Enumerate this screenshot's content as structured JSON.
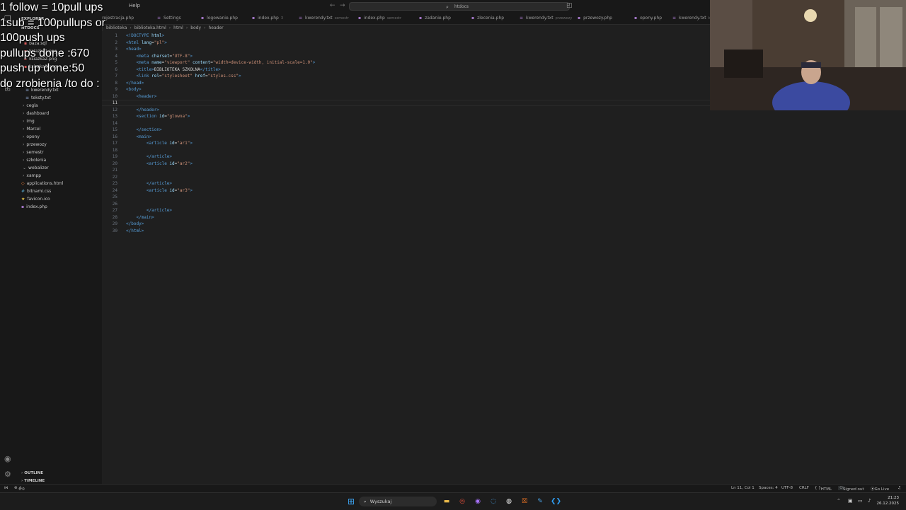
{
  "menu": {
    "help": "Help"
  },
  "search": {
    "text": "htdocs"
  },
  "overlay_lines": [
    "1 follow = 10pull ups",
    "1sub = 100pullups or",
    "100push ups",
    "pullups done :670",
    "push up done:50",
    "do zrobienia /to do :"
  ],
  "explorer": {
    "title": "EXPLORER",
    "root": "HTDOCS",
    "files_top": [
      "baza.sql",
      "ksiazka1.png",
      "ksiazka2.png",
      "ksiazka3.png"
    ],
    "files_txt": [
      "kwerendy.txt",
      "teksty.txt"
    ],
    "folders": [
      "cegla",
      "dashboard",
      "img",
      "Marcel",
      "opony",
      "przewozy",
      "semestr",
      "szkolenia",
      "webalizer",
      "xampp"
    ],
    "files_bottom": [
      "applications.html",
      "bitnami.css",
      "favicon.ico",
      "index.php"
    ],
    "outline": "OUTLINE",
    "timeline": "TIMELINE"
  },
  "tabs": [
    {
      "label": "rejestracja.php",
      "desc": ""
    },
    {
      "label": "Settings",
      "desc": ""
    },
    {
      "label": "logowanie.php",
      "desc": ""
    },
    {
      "label": "index.php",
      "desc": "3"
    },
    {
      "label": "kwerendy.txt",
      "desc": "semestr"
    },
    {
      "label": "index.php",
      "desc": "semestr"
    },
    {
      "label": "zadanie.php",
      "desc": ""
    },
    {
      "label": "zlecenia.php",
      "desc": ""
    },
    {
      "label": "kwerendy.txt",
      "desc": "przewozy"
    },
    {
      "label": "przewozy.php",
      "desc": ""
    },
    {
      "label": "opony.php",
      "desc": ""
    },
    {
      "label": "kwerendy.txt",
      "desc": "bi"
    }
  ],
  "breadcrumb": [
    "biblioteka",
    "biblioteka.html",
    "html",
    "body",
    "header"
  ],
  "code_lines": [
    {
      "n": "1",
      "t": [
        [
          "tg",
          "<!DOCTYPE "
        ],
        [
          "at",
          "html"
        ],
        [
          "tg",
          ">"
        ]
      ]
    },
    {
      "n": "2",
      "t": [
        [
          "tg",
          "<html "
        ],
        [
          "at",
          "lang"
        ],
        [
          "tx",
          "="
        ],
        [
          "st",
          "\"pl\""
        ],
        [
          "tg",
          ">"
        ]
      ]
    },
    {
      "n": "3",
      "t": [
        [
          "tg",
          "<head>"
        ]
      ]
    },
    {
      "n": "4",
      "t": [
        [
          "tx",
          "    "
        ],
        [
          "tg",
          "<meta "
        ],
        [
          "at",
          "charset"
        ],
        [
          "tx",
          "="
        ],
        [
          "st",
          "\"UTF-8\""
        ],
        [
          "tg",
          ">"
        ]
      ]
    },
    {
      "n": "5",
      "t": [
        [
          "tx",
          "    "
        ],
        [
          "tg",
          "<meta "
        ],
        [
          "at",
          "name"
        ],
        [
          "tx",
          "="
        ],
        [
          "st",
          "\"viewport\" "
        ],
        [
          "at",
          "content"
        ],
        [
          "tx",
          "="
        ],
        [
          "st",
          "\"width=device-width, initial-scale=1.0\""
        ],
        [
          "tg",
          ">"
        ]
      ]
    },
    {
      "n": "6",
      "t": [
        [
          "tx",
          "    "
        ],
        [
          "tg",
          "<title>"
        ],
        [
          "tx",
          "BIBLIOTEKA SZKOLNA"
        ],
        [
          "tg",
          "</title>"
        ]
      ]
    },
    {
      "n": "7",
      "t": [
        [
          "tx",
          "    "
        ],
        [
          "tg",
          "<link "
        ],
        [
          "at",
          "rel"
        ],
        [
          "tx",
          "="
        ],
        [
          "st",
          "\"stylesheet\" "
        ],
        [
          "at",
          "href"
        ],
        [
          "tx",
          "="
        ],
        [
          "st",
          "\"styles.css\""
        ],
        [
          "tg",
          ">"
        ]
      ]
    },
    {
      "n": "8",
      "t": [
        [
          "tg",
          "</head>"
        ]
      ]
    },
    {
      "n": "9",
      "t": [
        [
          "tg",
          "<body>"
        ]
      ]
    },
    {
      "n": "10",
      "t": [
        [
          "tx",
          "    "
        ],
        [
          "tg",
          "<header>"
        ]
      ]
    },
    {
      "n": "11",
      "t": []
    },
    {
      "n": "12",
      "t": [
        [
          "tx",
          "    "
        ],
        [
          "tg",
          "</header>"
        ]
      ]
    },
    {
      "n": "13",
      "t": [
        [
          "tx",
          "    "
        ],
        [
          "tg",
          "<section "
        ],
        [
          "at",
          "id"
        ],
        [
          "tx",
          "="
        ],
        [
          "st",
          "\"glowna\""
        ],
        [
          "tg",
          ">"
        ]
      ]
    },
    {
      "n": "14",
      "t": []
    },
    {
      "n": "15",
      "t": [
        [
          "tx",
          "    "
        ],
        [
          "tg",
          "</section>"
        ]
      ]
    },
    {
      "n": "16",
      "t": [
        [
          "tx",
          "    "
        ],
        [
          "tg",
          "<main>"
        ]
      ]
    },
    {
      "n": "17",
      "t": [
        [
          "tx",
          "        "
        ],
        [
          "tg",
          "<article "
        ],
        [
          "at",
          "id"
        ],
        [
          "tx",
          "="
        ],
        [
          "st",
          "\"ar1\""
        ],
        [
          "tg",
          ">"
        ]
      ]
    },
    {
      "n": "18",
      "t": []
    },
    {
      "n": "19",
      "t": [
        [
          "tx",
          "        "
        ],
        [
          "tg",
          "</article>"
        ]
      ]
    },
    {
      "n": "20",
      "t": [
        [
          "tx",
          "        "
        ],
        [
          "tg",
          "<article "
        ],
        [
          "at",
          "id"
        ],
        [
          "tx",
          "="
        ],
        [
          "st",
          "\"ar2\""
        ],
        [
          "tg",
          ">"
        ]
      ]
    },
    {
      "n": "21",
      "t": []
    },
    {
      "n": "22",
      "t": []
    },
    {
      "n": "23",
      "t": [
        [
          "tx",
          "        "
        ],
        [
          "tg",
          "</article>"
        ]
      ]
    },
    {
      "n": "24",
      "t": [
        [
          "tx",
          "        "
        ],
        [
          "tg",
          "<article "
        ],
        [
          "at",
          "id"
        ],
        [
          "tx",
          "="
        ],
        [
          "st",
          "\"ar3\""
        ],
        [
          "tg",
          ">"
        ]
      ]
    },
    {
      "n": "25",
      "t": []
    },
    {
      "n": "26",
      "t": []
    },
    {
      "n": "27",
      "t": [
        [
          "tx",
          "        "
        ],
        [
          "tg",
          "</article>"
        ]
      ]
    },
    {
      "n": "28",
      "t": [
        [
          "tx",
          "    "
        ],
        [
          "tg",
          "</main>"
        ]
      ]
    },
    {
      "n": "29",
      "t": [
        [
          "tg",
          "</body>"
        ]
      ]
    },
    {
      "n": "30",
      "t": [
        [
          "tg",
          "</html>"
        ]
      ]
    }
  ],
  "current_line": "11",
  "status": {
    "errors": "0",
    "warnings": "0",
    "position": "Ln 11, Col 1",
    "spaces": "Spaces: 4",
    "encoding": "UTF-8",
    "eol": "CRLF",
    "language": "HTML",
    "account": "Signed out",
    "golive": "Go Live"
  },
  "taskbar": {
    "search": "Wyszukaj",
    "time": "21:23",
    "date": "26.12.2025"
  },
  "colors": {
    "accent": "#0078d4",
    "tag": "#569cd6",
    "attr": "#9cdcfe",
    "string": "#ce9178"
  }
}
